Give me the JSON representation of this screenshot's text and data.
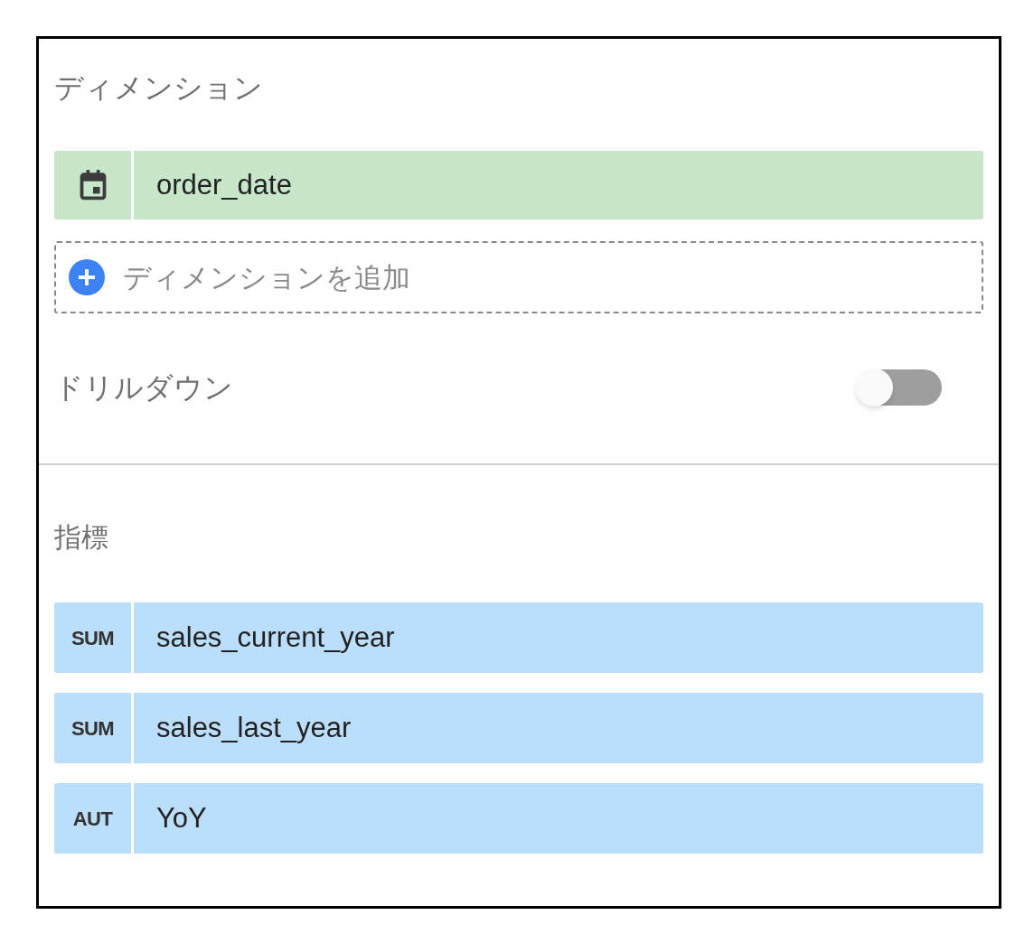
{
  "dimensions": {
    "title": "ディメンション",
    "items": [
      {
        "kind": "date",
        "label": "order_date"
      }
    ],
    "add": {
      "label": "ディメンションを追加"
    }
  },
  "drilldown": {
    "label": "ドリルダウン",
    "on": false
  },
  "metrics": {
    "title": "指標",
    "items": [
      {
        "aggregation": "SUM",
        "label": "sales_current_year"
      },
      {
        "aggregation": "SUM",
        "label": "sales_last_year"
      },
      {
        "aggregation": "AUT",
        "label": "YoY"
      }
    ]
  }
}
